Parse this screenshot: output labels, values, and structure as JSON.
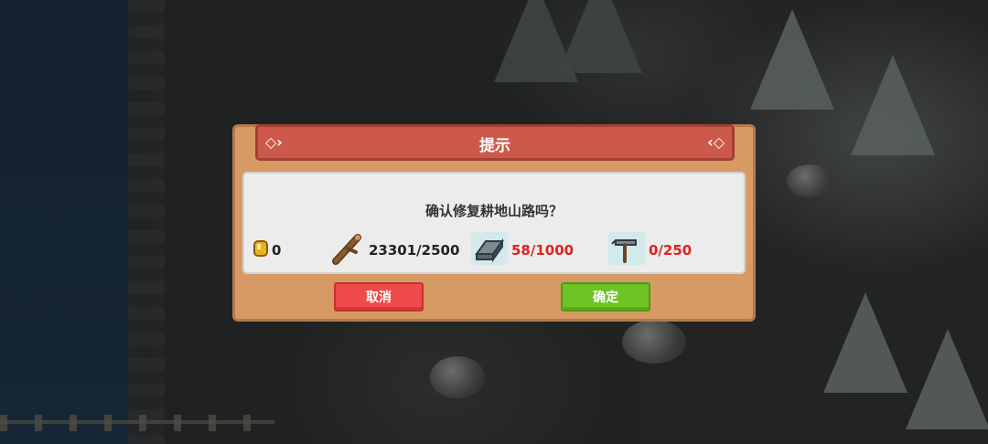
{
  "dialog": {
    "title": "提示",
    "message": "确认修复耕地山路吗？",
    "decor_left": "◇›",
    "decor_right": "‹◇"
  },
  "costs": [
    {
      "icon": "gold-coin-icon",
      "value": "0",
      "status": "ok"
    },
    {
      "icon": "wood-log-icon",
      "value": "23301/2500",
      "status": "ok"
    },
    {
      "icon": "iron-ingot-icon",
      "value": "58/1000",
      "status": "short"
    },
    {
      "icon": "hammer-icon",
      "value": "0/250",
      "status": "short"
    }
  ],
  "buttons": {
    "cancel_label": "取消",
    "confirm_label": "确定"
  },
  "colors": {
    "header": "#cc5949",
    "panel": "#d79a64",
    "cancel": "#ef4b4b",
    "confirm": "#6dc424",
    "insufficient": "#e0221b"
  }
}
